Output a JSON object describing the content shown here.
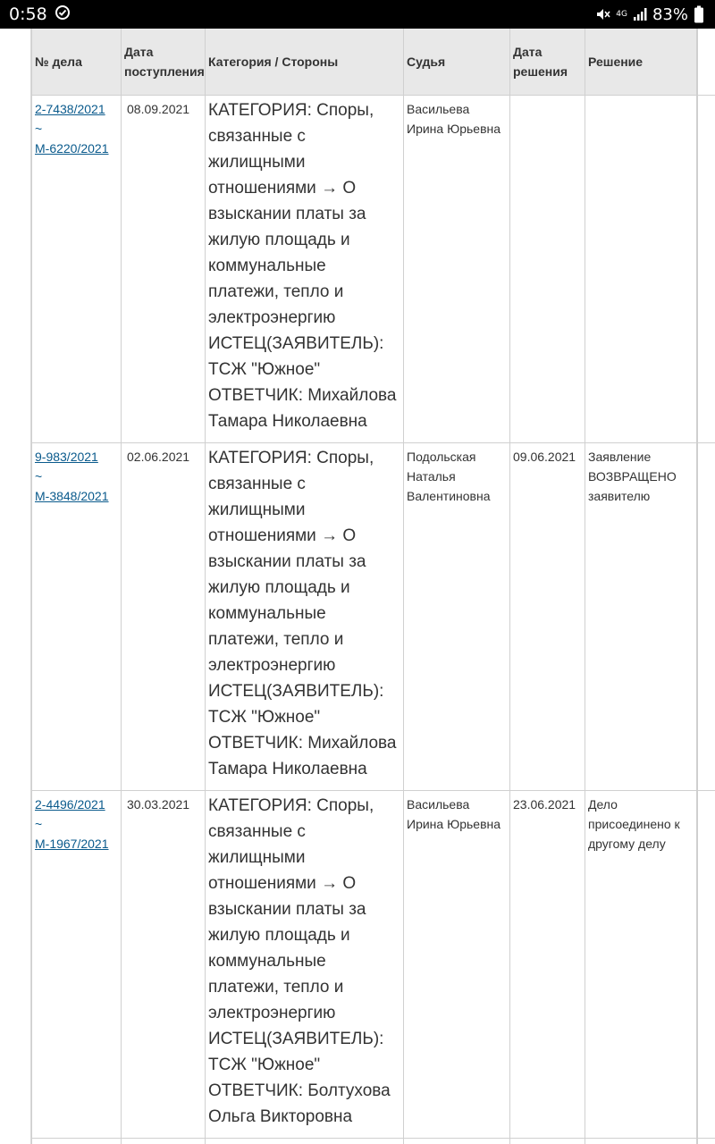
{
  "status_bar": {
    "time": "0:58",
    "battery": "83%",
    "network": "4G"
  },
  "table": {
    "headers": {
      "case_no": "№ дела",
      "date_received": "Дата поступления",
      "category": "Категория / Стороны",
      "judge": "Судья",
      "date_decision": "Дата решения",
      "decision": "Решение"
    },
    "rows": [
      {
        "case_link": "2-7438/2021",
        "tilde": "~",
        "material_link": "М-6220/2021",
        "date_received": "08.09.2021",
        "category": "КАТЕГОРИЯ: Споры, связанные с жилищными отношениями → О взыскании платы за жилую площадь и коммунальные платежи, тепло и электроэнергию",
        "plaintiff": "ИСТЕЦ(ЗАЯВИТЕЛЬ): ТСЖ \"Южное\"",
        "defendant": "ОТВЕТЧИК: Михайлова Тамара Николаевна",
        "judge": "Васильева Ирина Юрьевна",
        "date_decision": "",
        "decision": ""
      },
      {
        "case_link": "9-983/2021",
        "tilde": "~",
        "material_link": "М-3848/2021",
        "date_received": "02.06.2021",
        "category": "КАТЕГОРИЯ: Споры, связанные с жилищными отношениями → О взыскании платы за жилую площадь и коммунальные платежи, тепло и электроэнергию",
        "plaintiff": "ИСТЕЦ(ЗАЯВИТЕЛЬ): ТСЖ \"Южное\"",
        "defendant": "ОТВЕТЧИК: Михайлова Тамара Николаевна",
        "judge": "Подольская Наталья Валентиновна",
        "date_decision": "09.06.2021",
        "decision": "Заявление ВОЗВРАЩЕНО заявителю"
      },
      {
        "case_link": "2-4496/2021",
        "tilde": "~",
        "material_link": "М-1967/2021",
        "date_received": "30.03.2021",
        "category": "КАТЕГОРИЯ: Споры, связанные с жилищными отношениями → О взыскании платы за жилую площадь и коммунальные платежи, тепло и электроэнергию",
        "plaintiff": "ИСТЕЦ(ЗАЯВИТЕЛЬ): ТСЖ \"Южное\"",
        "defendant": "ОТВЕТЧИК: Болтухова Ольга Викторовна",
        "judge": "Васильева Ирина Юрьевна",
        "date_decision": "23.06.2021",
        "decision": "Дело присоединено к другому делу"
      }
    ]
  }
}
